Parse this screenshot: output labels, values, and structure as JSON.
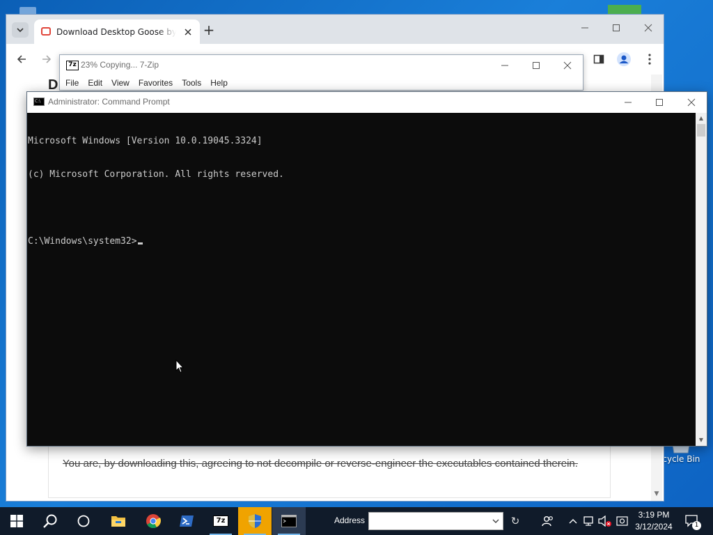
{
  "desktop": {
    "recycle_bin_label": "ecycle Bin"
  },
  "browser": {
    "tab_title": "Download Desktop Goose by samperson",
    "new_tab_symbol": "+",
    "page_heading_partial": "D",
    "page_text": "You are, by downloading this, agreeing to not decompile or reverse-engineer the executables contained therein."
  },
  "zip_window": {
    "title": "23% Copying... 7-Zip",
    "icon_text": "7z",
    "menu": [
      "File",
      "Edit",
      "View",
      "Favorites",
      "Tools",
      "Help"
    ]
  },
  "cmd_window": {
    "title": "Administrator: Command Prompt",
    "lines": [
      "Microsoft Windows [Version 10.0.19045.3324]",
      "(c) Microsoft Corporation. All rights reserved.",
      "",
      "C:\\Windows\\system32>"
    ]
  },
  "taskbar": {
    "address_label": "Address",
    "address_value": "",
    "time": "3:19 PM",
    "date": "3/12/2024",
    "notification_count": "1",
    "pinned_icons": [
      "windows-start-icon",
      "search-icon",
      "task-view-icon",
      "file-explorer-icon",
      "chrome-icon",
      "powershell-icon",
      "7zip-icon",
      "shield-setup-icon",
      "command-prompt-icon"
    ]
  },
  "colors": {
    "desktop_blue": "#0b5fb6",
    "taskbar": "#101b2a",
    "cmd_background": "#0c0c0c",
    "cmd_text": "#cccccc"
  }
}
